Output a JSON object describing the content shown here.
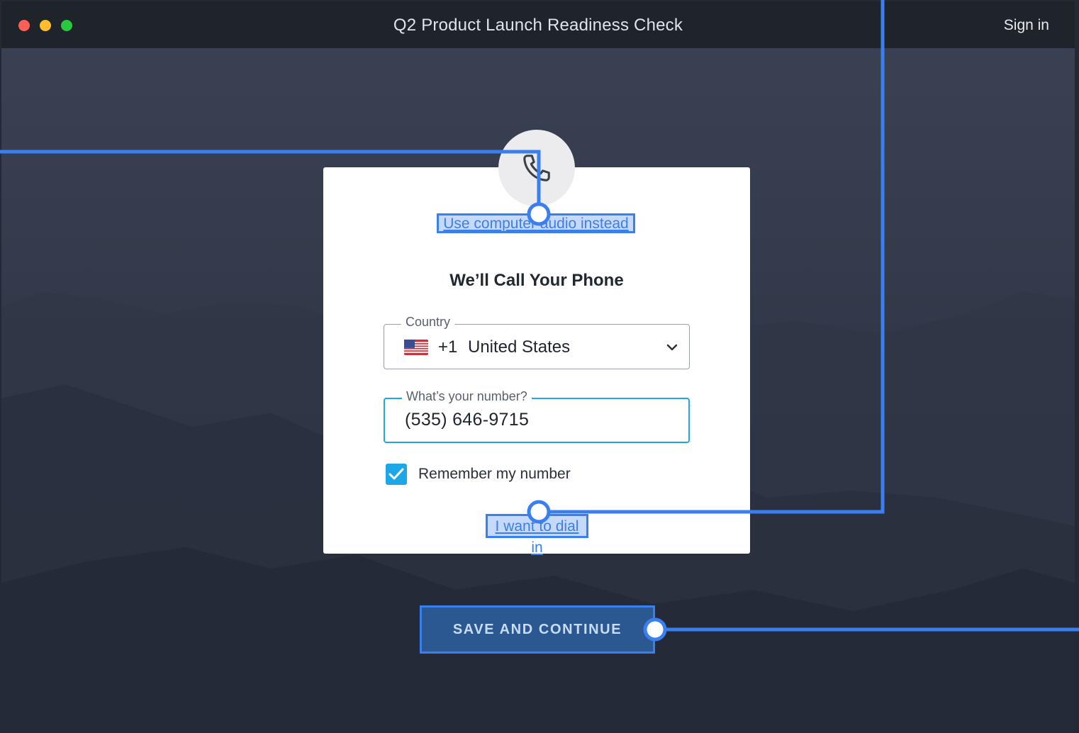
{
  "window": {
    "title": "Q2 Product Launch Readiness Check",
    "signin_label": "Sign in"
  },
  "dialog": {
    "icon": "phone-icon",
    "computer_audio_link": "Use computer audio instead",
    "heading": "We’ll Call Your Phone",
    "country": {
      "label": "Country",
      "flag": "us-flag-icon",
      "code": "+1",
      "name": "United States"
    },
    "phone": {
      "label": "What’s your number?",
      "value": "(535) 646-9715"
    },
    "remember": {
      "label": "Remember my number",
      "checked": true
    },
    "dial_in_link": "I want to dial in"
  },
  "actions": {
    "save_label": "SAVE AND CONTINUE"
  },
  "colors": {
    "accent": "#1ea7e6",
    "annotation": "#3a7ff0",
    "button": "#2b5891"
  }
}
